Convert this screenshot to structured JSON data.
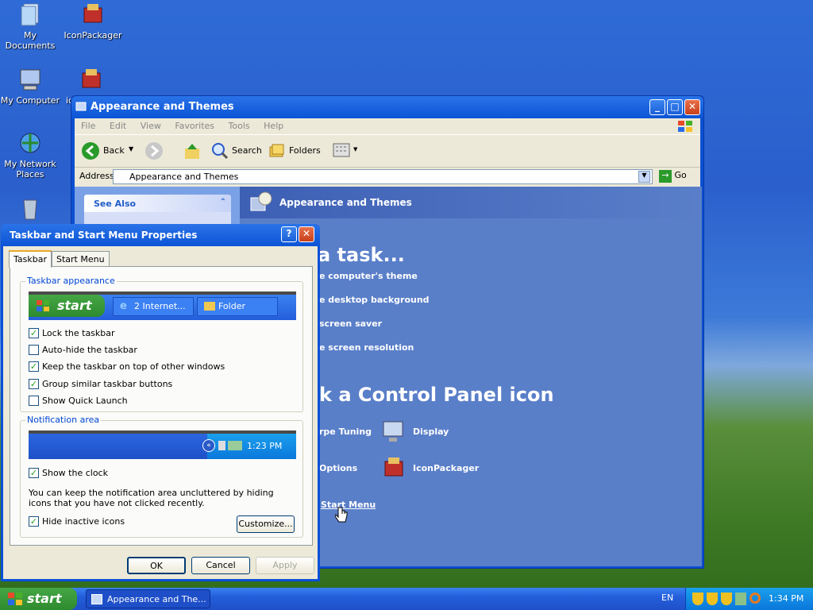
{
  "desktop": {
    "icons": [
      {
        "label": "My Documents"
      },
      {
        "label": "IconPackager"
      },
      {
        "label": "My Computer"
      },
      {
        "label": "ic"
      },
      {
        "label": "My Network Places"
      }
    ]
  },
  "main_window": {
    "title": "Appearance and Themes",
    "menu": [
      "File",
      "Edit",
      "View",
      "Favorites",
      "Tools",
      "Help"
    ],
    "toolbar": {
      "back": "Back",
      "search": "Search",
      "folders": "Folders"
    },
    "address_label": "Address",
    "address_value": "Appearance and Themes",
    "go": "Go",
    "see_also": "See Also",
    "header": "Appearance and Themes",
    "pick_task": "a task...",
    "tasks": [
      "e computer's theme",
      "e desktop background",
      "screen saver",
      "e screen resolution"
    ],
    "pick_icon": "k a Control Panel icon",
    "icons": [
      "rpe Tuning",
      "Display",
      "Options",
      "IconPackager",
      "Start Menu"
    ]
  },
  "dialog": {
    "title": "Taskbar and Start Menu Properties",
    "tabs": [
      "Taskbar",
      "Start Menu"
    ],
    "group1": "Taskbar appearance",
    "preview": {
      "start": "start",
      "btn1": "2 Internet...",
      "btn2": "Folder"
    },
    "checks": [
      {
        "label": "Lock the taskbar",
        "checked": true
      },
      {
        "label": "Auto-hide the taskbar",
        "checked": false
      },
      {
        "label": "Keep the taskbar on top of other windows",
        "checked": true
      },
      {
        "label": "Group similar taskbar buttons",
        "checked": true
      },
      {
        "label": "Show Quick Launch",
        "checked": false
      }
    ],
    "group2": "Notification area",
    "notif_time": "1:23 PM",
    "show_clock": "Show the clock",
    "note": "You can keep the notification area uncluttered by hiding icons that you have not clicked recently.",
    "hide_inactive": "Hide inactive icons",
    "customize": "Customize...",
    "ok": "OK",
    "cancel": "Cancel",
    "apply": "Apply"
  },
  "taskbar": {
    "start": "start",
    "task": "Appearance and The...",
    "lang": "EN",
    "time": "1:34 PM"
  }
}
